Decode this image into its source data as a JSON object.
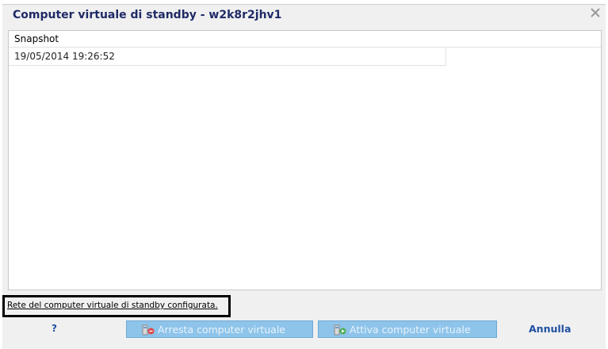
{
  "dialog": {
    "title": "Computer virtuale di standby - w2k8r2jhv1",
    "close_icon": "close-icon"
  },
  "snapshot_list": {
    "column_header": "Snapshot",
    "rows": [
      "19/05/2014 19:26:52"
    ]
  },
  "network_status": {
    "text": "Rete del computer virtuale di standby configurata."
  },
  "footer": {
    "help_label": "?",
    "stop_vm_label": "Arresta computer virtuale",
    "start_vm_label": "Attiva computer virtuale",
    "cancel_label": "Annulla"
  },
  "colors": {
    "title": "#1f2a66",
    "button_disabled_bg": "#8ec4ea",
    "link": "#1f4fa0"
  }
}
